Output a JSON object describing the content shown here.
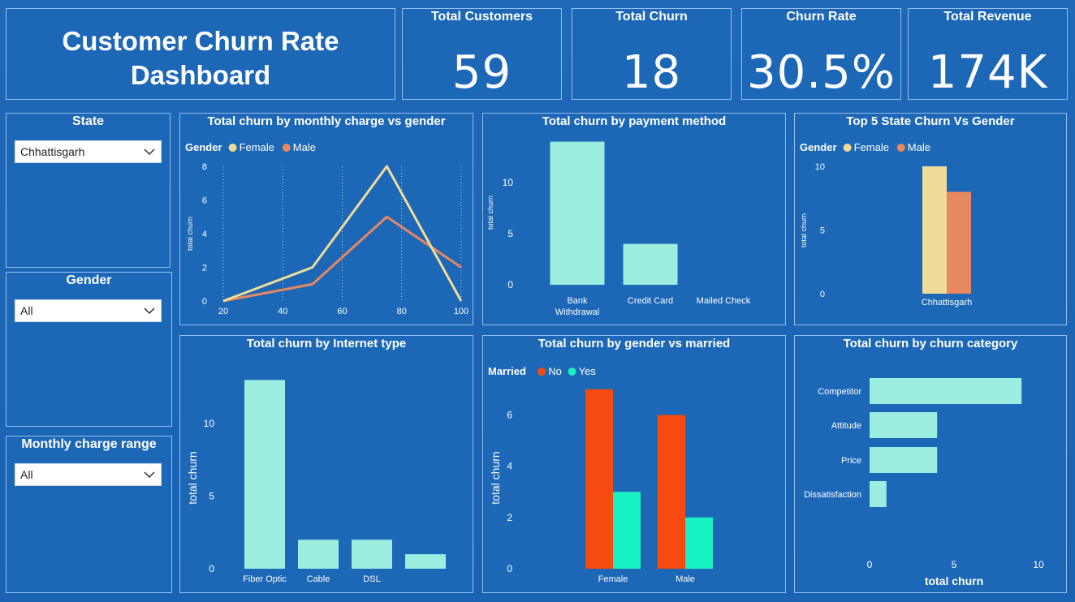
{
  "header": {
    "title_line1": "Customer Churn Rate",
    "title_line2": "Dashboard"
  },
  "kpis": [
    {
      "label": "Total Customers",
      "value": "59"
    },
    {
      "label": "Total Churn",
      "value": "18"
    },
    {
      "label": "Churn Rate",
      "value": "30.5%"
    },
    {
      "label": "Total Revenue",
      "value": "174K"
    }
  ],
  "slicers": {
    "state": {
      "label": "State",
      "value": "Chhattisgarh"
    },
    "gender": {
      "label": "Gender",
      "value": "All"
    },
    "monthly": {
      "label": "Monthly charge range",
      "value": "All"
    }
  },
  "colors": {
    "female": "#f0dc99",
    "male": "#e8885f",
    "bar": "#9bede0",
    "married_no": "#f64a0e",
    "married_yes": "#18f1c1"
  },
  "chart_data": [
    {
      "id": "monthly",
      "type": "line",
      "title": "Total churn by monthly charge vs gender",
      "legend_title": "Gender",
      "ylabel": "total churn",
      "x": [
        20,
        50,
        75,
        100
      ],
      "xticks": [
        20,
        40,
        60,
        80,
        100
      ],
      "yticks": [
        0,
        2,
        4,
        6,
        8
      ],
      "xlim": [
        20,
        100
      ],
      "ylim": [
        0,
        8
      ],
      "series": [
        {
          "name": "Female",
          "values": [
            0,
            2,
            8,
            0
          ]
        },
        {
          "name": "Male",
          "values": [
            0,
            1,
            5,
            2
          ]
        }
      ]
    },
    {
      "id": "payment",
      "type": "bar",
      "title": "Total churn by payment method",
      "ylabel": "total churn",
      "categories": [
        "Bank Withdrawal",
        "Credit Card",
        "Mailed Check"
      ],
      "values": [
        14,
        4,
        0
      ],
      "yticks": [
        0,
        5,
        10
      ],
      "ylim": [
        0,
        14
      ]
    },
    {
      "id": "top5",
      "type": "bar",
      "title": "Top 5 State Churn Vs Gender",
      "legend_title": "Gender",
      "ylabel": "total churn",
      "categories": [
        "Chhattisgarh"
      ],
      "series": [
        {
          "name": "Female",
          "values": [
            10
          ]
        },
        {
          "name": "Male",
          "values": [
            8
          ]
        }
      ],
      "yticks": [
        0,
        5,
        10
      ],
      "ylim": [
        0,
        10
      ]
    },
    {
      "id": "internet",
      "type": "bar",
      "title": "Total churn by Internet type",
      "ylabel": "total churn",
      "categories": [
        "Fiber Optic",
        "Cable",
        "DSL",
        ""
      ],
      "values": [
        13,
        2,
        2,
        1
      ],
      "yticks": [
        0,
        5,
        10
      ],
      "ylim": [
        0,
        13
      ]
    },
    {
      "id": "married",
      "type": "bar",
      "title": "Total churn by gender vs married",
      "legend_title": "Married",
      "ylabel": "total churn",
      "categories": [
        "Female",
        "Male"
      ],
      "series": [
        {
          "name": "No",
          "values": [
            7,
            6
          ]
        },
        {
          "name": "Yes",
          "values": [
            3,
            2
          ]
        }
      ],
      "yticks": [
        0,
        2,
        4,
        6
      ],
      "ylim": [
        0,
        7
      ]
    },
    {
      "id": "category",
      "type": "bar",
      "orientation": "horizontal",
      "title": "Total churn by churn category",
      "xlabel": "total churn",
      "categories": [
        "Competitor",
        "Attitude",
        "Price",
        "Dissatisfaction"
      ],
      "values": [
        9,
        4,
        4,
        1
      ],
      "xticks": [
        0,
        5,
        10
      ],
      "xlim": [
        0,
        10
      ]
    }
  ]
}
